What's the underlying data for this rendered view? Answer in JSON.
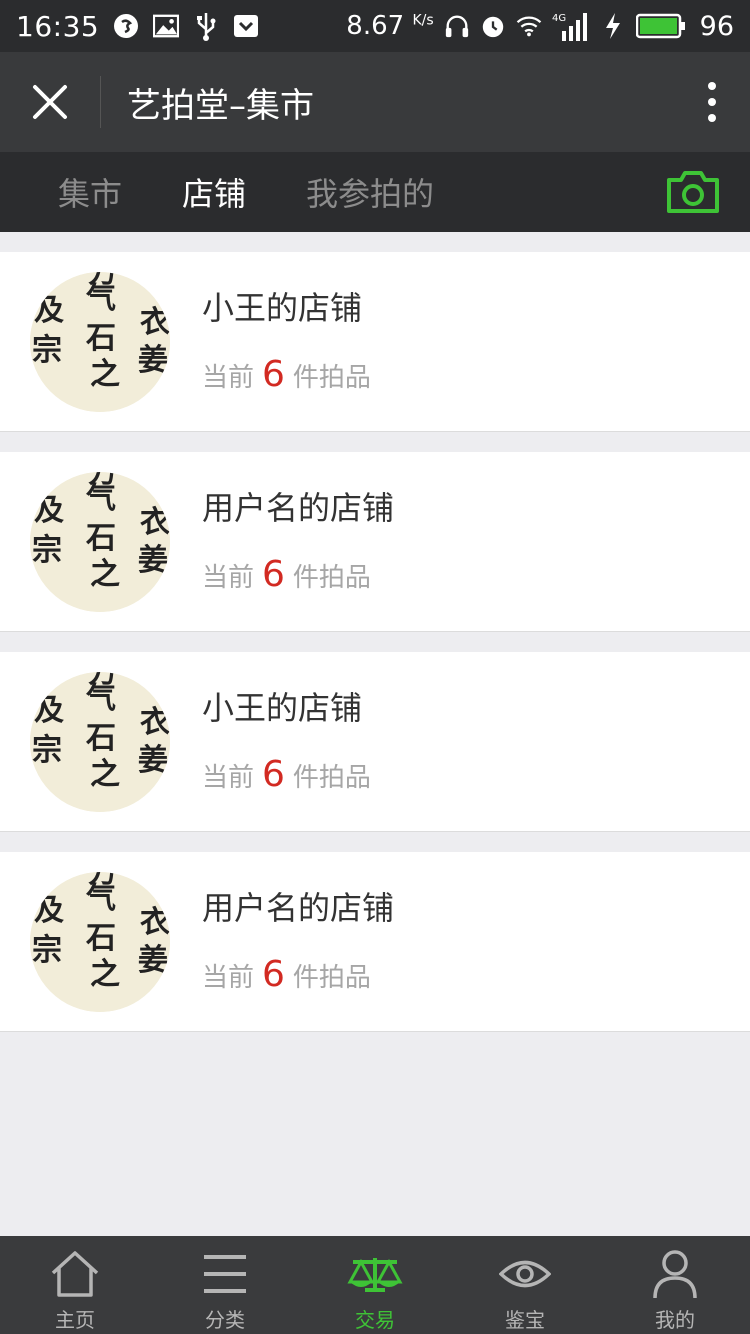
{
  "statusbar": {
    "time": "16:35",
    "speed": "8.67",
    "speed_unit": "K/s",
    "network": "4G",
    "battery": "96"
  },
  "header": {
    "title": "艺拍堂–集市"
  },
  "tabs": [
    {
      "label": "集市",
      "active": false
    },
    {
      "label": "店铺",
      "active": true
    },
    {
      "label": "我参拍的",
      "active": false
    }
  ],
  "shops": [
    {
      "name": "小王的店铺",
      "prefix": "当前",
      "count": "6",
      "suffix": "件拍品"
    },
    {
      "name": "用户名的店铺",
      "prefix": "当前",
      "count": "6",
      "suffix": "件拍品"
    },
    {
      "name": "小王的店铺",
      "prefix": "当前",
      "count": "6",
      "suffix": "件拍品"
    },
    {
      "name": "用户名的店铺",
      "prefix": "当前",
      "count": "6",
      "suffix": "件拍品"
    }
  ],
  "bottom_nav": [
    {
      "label": "主页",
      "icon": "home-icon",
      "active": false
    },
    {
      "label": "分类",
      "icon": "category-icon",
      "active": false
    },
    {
      "label": "交易",
      "icon": "trade-icon",
      "active": true
    },
    {
      "label": "鉴宝",
      "icon": "eye-icon",
      "active": false
    },
    {
      "label": "我的",
      "icon": "user-icon",
      "active": false
    }
  ],
  "colors": {
    "accent": "#3ec336",
    "count": "#d22a22",
    "header": "#393a3c",
    "tabbar": "#2b2c2e"
  }
}
